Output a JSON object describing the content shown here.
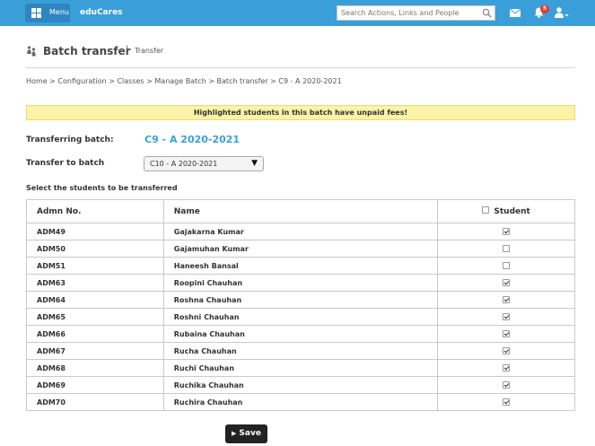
{
  "topbar": {
    "menu_label": "Menu",
    "brand": "eduCares",
    "search_placeholder": "Search Actions, Links and People",
    "notification_count": "5",
    "bar_color": "#3a9fd9"
  },
  "page": {
    "title": "Batch transfer",
    "separator": "|",
    "subtitle": "Transfer"
  },
  "breadcrumb": "Home > Configuration > Classes > Manage Batch > Batch transfer > C9 - A 2020-2021",
  "alert": "Highlighted students in this batch have unpaid fees!",
  "form": {
    "transferring_label": "Transferring batch:",
    "transferring_value": "C9 - A 2020-2021",
    "transfer_to_label": "Transfer to batch",
    "transfer_to_value": "C10 - A 2020-2021",
    "select_students_label": "Select the students to be transferred"
  },
  "table": {
    "headers": [
      "Admn No.",
      "Name",
      "Student"
    ],
    "rows": [
      {
        "admn": "ADM49",
        "name": "Gajakarna Kumar",
        "checked": true
      },
      {
        "admn": "ADM50",
        "name": "Gajamuhan Kumar",
        "checked": false
      },
      {
        "admn": "ADM51",
        "name": "Haneesh Bansal",
        "checked": false
      },
      {
        "admn": "ADM63",
        "name": "Roopini Chauhan",
        "checked": true
      },
      {
        "admn": "ADM64",
        "name": "Roshna Chauhan",
        "checked": true
      },
      {
        "admn": "ADM65",
        "name": "Roshni Chauhan",
        "checked": true
      },
      {
        "admn": "ADM66",
        "name": "Rubaina Chauhan",
        "checked": true
      },
      {
        "admn": "ADM67",
        "name": "Rucha Chauhan",
        "checked": true
      },
      {
        "admn": "ADM68",
        "name": "Ruchi Chauhan",
        "checked": true
      },
      {
        "admn": "ADM69",
        "name": "Ruchika Chauhan",
        "checked": true
      },
      {
        "admn": "ADM70",
        "name": "Ruchira Chauhan",
        "checked": true
      }
    ]
  },
  "save_label": "Save"
}
